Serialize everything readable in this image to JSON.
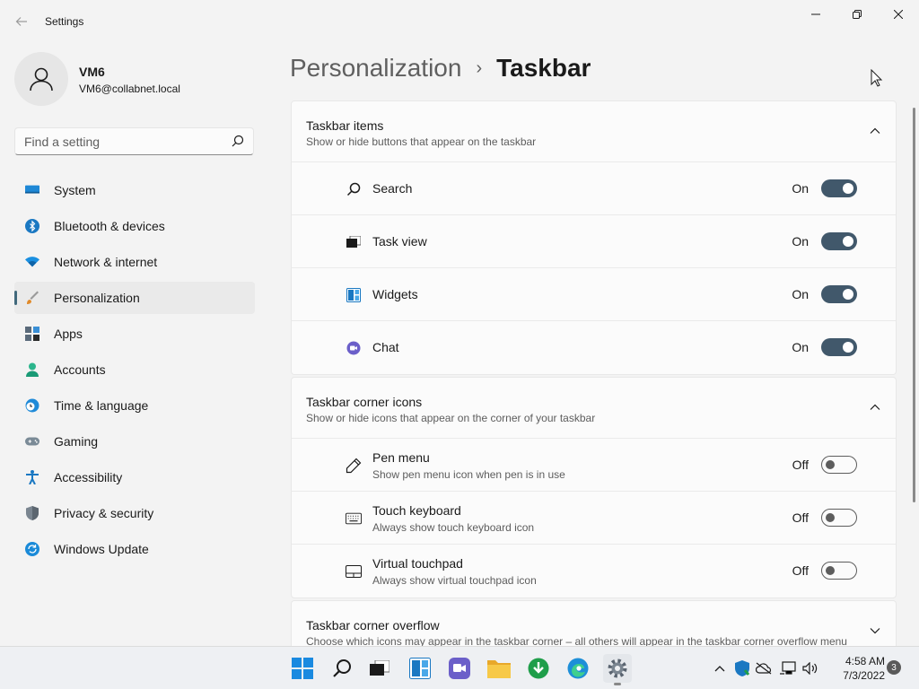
{
  "window": {
    "title": "Settings"
  },
  "profile": {
    "name": "VM6",
    "email": "VM6@collabnet.local"
  },
  "search": {
    "placeholder": "Find a setting"
  },
  "nav": {
    "items": [
      {
        "label": "System",
        "icon": "monitor-icon"
      },
      {
        "label": "Bluetooth & devices",
        "icon": "bluetooth-icon"
      },
      {
        "label": "Network & internet",
        "icon": "wifi-icon"
      },
      {
        "label": "Personalization",
        "icon": "brush-icon",
        "active": true
      },
      {
        "label": "Apps",
        "icon": "apps-icon"
      },
      {
        "label": "Accounts",
        "icon": "person-icon"
      },
      {
        "label": "Time & language",
        "icon": "clock-globe-icon"
      },
      {
        "label": "Gaming",
        "icon": "gamepad-icon"
      },
      {
        "label": "Accessibility",
        "icon": "accessibility-icon"
      },
      {
        "label": "Privacy & security",
        "icon": "shield-icon"
      },
      {
        "label": "Windows Update",
        "icon": "update-icon"
      }
    ]
  },
  "breadcrumb": {
    "parent": "Personalization",
    "separator": "›",
    "current": "Taskbar"
  },
  "sections": {
    "taskbar_items": {
      "title": "Taskbar items",
      "subtitle": "Show or hide buttons that appear on the taskbar",
      "rows": [
        {
          "label": "Search",
          "state": "On",
          "on": true,
          "icon": "search-icon"
        },
        {
          "label": "Task view",
          "state": "On",
          "on": true,
          "icon": "task-view-icon"
        },
        {
          "label": "Widgets",
          "state": "On",
          "on": true,
          "icon": "widgets-icon"
        },
        {
          "label": "Chat",
          "state": "On",
          "on": true,
          "icon": "chat-icon"
        }
      ]
    },
    "corner_icons": {
      "title": "Taskbar corner icons",
      "subtitle": "Show or hide icons that appear on the corner of your taskbar",
      "rows": [
        {
          "label": "Pen menu",
          "desc": "Show pen menu icon when pen is in use",
          "state": "Off",
          "on": false,
          "icon": "pen-icon"
        },
        {
          "label": "Touch keyboard",
          "desc": "Always show touch keyboard icon",
          "state": "Off",
          "on": false,
          "icon": "keyboard-icon"
        },
        {
          "label": "Virtual touchpad",
          "desc": "Always show virtual touchpad icon",
          "state": "Off",
          "on": false,
          "icon": "touchpad-icon"
        }
      ]
    },
    "corner_overflow": {
      "title": "Taskbar corner overflow",
      "subtitle": "Choose which icons may appear in the taskbar corner – all others will appear in the taskbar corner overflow menu"
    }
  },
  "taskbar": {
    "clock_time": "4:58 AM",
    "clock_date": "7/3/2022",
    "notification_count": "3"
  },
  "colors": {
    "accent": "#41697c",
    "toggle_on": "#41586b",
    "background": "#f3f3f3",
    "card": "#fbfbfb"
  }
}
